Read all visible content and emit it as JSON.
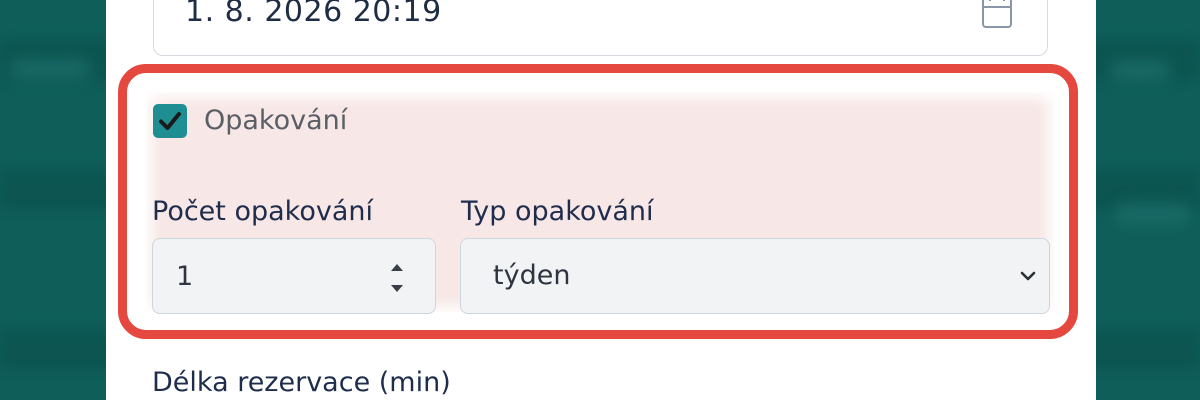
{
  "colors": {
    "backdrop": "#0f5e5a",
    "highlight_border": "#e5483f",
    "checkbox_accent": "#1e8e92",
    "label_text": "#1f2d4d"
  },
  "date_field": {
    "value": "1. 8. 2026 20:19",
    "icon": "calendar-icon"
  },
  "recurrence": {
    "checkbox_label": "Opakování",
    "checked": true,
    "count": {
      "label": "Počet opakování",
      "value": "1"
    },
    "type": {
      "label": "Typ opakování",
      "selected": "týden",
      "icon": "chevron-down-icon"
    }
  },
  "duration": {
    "label": "Délka rezervace (min)"
  }
}
